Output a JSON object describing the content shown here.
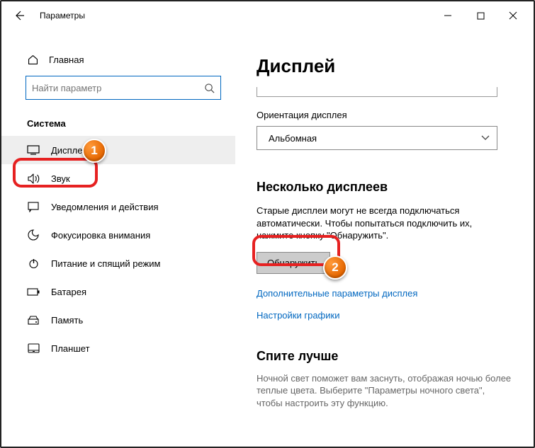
{
  "window": {
    "title": "Параметры"
  },
  "sidebar": {
    "home": "Главная",
    "search_placeholder": "Найти параметр",
    "section": "Система",
    "items": [
      {
        "label": "Дисплей"
      },
      {
        "label": "Звук"
      },
      {
        "label": "Уведомления и действия"
      },
      {
        "label": "Фокусировка внимания"
      },
      {
        "label": "Питание и спящий режим"
      },
      {
        "label": "Батарея"
      },
      {
        "label": "Память"
      },
      {
        "label": "Планшет"
      }
    ]
  },
  "main": {
    "title": "Дисплей",
    "orientation_label": "Ориентация дисплея",
    "orientation_value": "Альбомная",
    "multi_heading": "Несколько дисплеев",
    "multi_body": "Старые дисплеи могут не всегда подключаться автоматически. Чтобы попытаться подключить их, нажмите кнопку \"Обнаружить\".",
    "detect_btn": "Обнаружить",
    "link_advanced": "Дополнительные параметры дисплея",
    "link_graphics": "Настройки графики",
    "sleep_heading": "Спите лучше",
    "sleep_body": "Ночной свет поможет вам заснуть, отображая ночью более теплые цвета. Выберите \"Параметры ночного света\", чтобы настроить эту функцию."
  },
  "callouts": {
    "one": "1",
    "two": "2"
  }
}
